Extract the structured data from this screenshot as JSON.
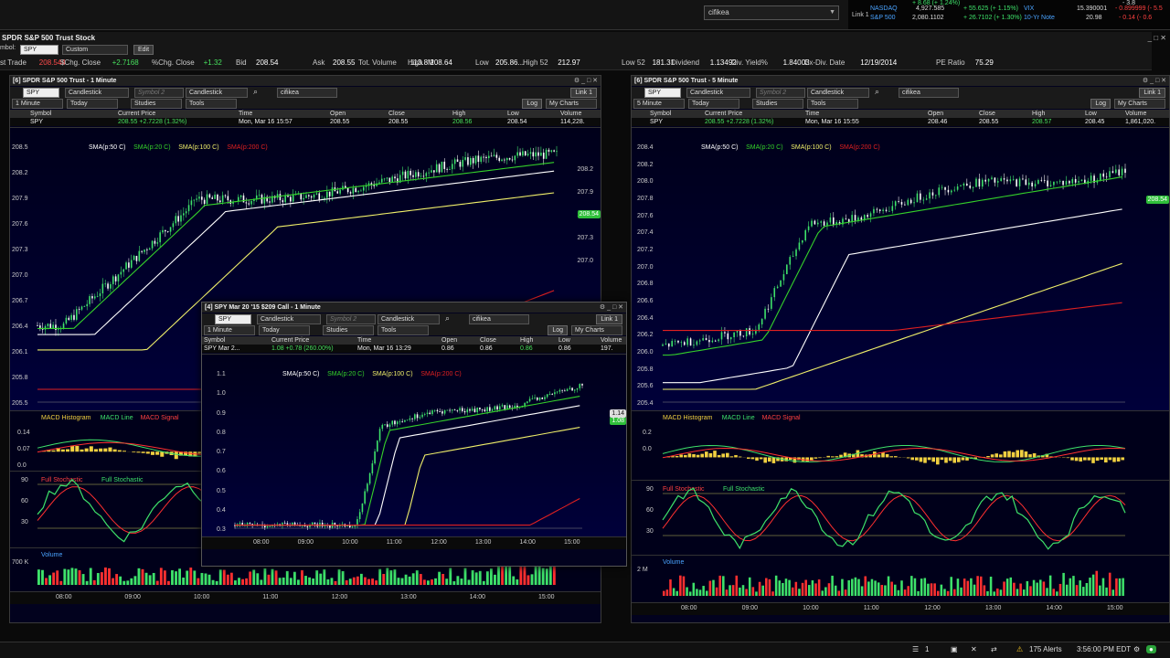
{
  "command": {
    "value": "cifikea"
  },
  "tickers": [
    {
      "name": "NASDAQ",
      "value": "4,927.585",
      "change": "+ 55.625 (+ 1.15%)",
      "name2": "VIX",
      "value2": "15.390001",
      "change2": "- 0.899999 (- 5.5"
    },
    {
      "name": "S&P 500",
      "value": "2,080.1102",
      "change": "+ 26.7102 (+ 1.30%)",
      "name2": "10-Yr Note",
      "value2": "20.98",
      "change2": "- 0.14 (- 0.6"
    }
  ],
  "link_label": "Link 1",
  "main": {
    "title": "SPDR S&P 500 Trust Stock",
    "symbol_label": "mbol:",
    "symbol": "SPY",
    "layout": "Custom",
    "edit_label": "Edit",
    "quote": [
      {
        "label": "st Trade",
        "value": "208.544",
        "tone": "red"
      },
      {
        "label": "$Chg. Close",
        "value": "+2.7168",
        "tone": "green"
      },
      {
        "label": "%Chg. Close",
        "value": "+1.32",
        "tone": "green"
      },
      {
        "label": "Bid",
        "value": "208.54",
        "tone": "val"
      },
      {
        "label": "Ask",
        "value": "208.55",
        "tone": "val"
      },
      {
        "label": "Tot. Volume",
        "value": "113.8M",
        "tone": "val"
      },
      {
        "label": "High",
        "value": "208.64",
        "tone": "val"
      },
      {
        "label": "Low",
        "value": "205.86...",
        "tone": "val"
      },
      {
        "label": "High 52",
        "value": "212.97",
        "tone": "val"
      },
      {
        "label": "Low 52",
        "value": "181.31",
        "tone": "val"
      },
      {
        "label": "Dividend",
        "value": "1.13492",
        "tone": "val"
      },
      {
        "label": "Div. Yield%",
        "value": "1.84003",
        "tone": "val"
      },
      {
        "label": "Ex-Div. Date",
        "value": "12/19/2014",
        "tone": "val"
      },
      {
        "label": "PE Ratio",
        "value": "75.29",
        "tone": "val"
      }
    ]
  },
  "toolbar_common": {
    "symbol2_placeholder": "Symbol 2",
    "style": "Candlestick",
    "today": "Today",
    "studies": "Studies",
    "tools": "Tools",
    "log": "Log",
    "my_charts": "My Charts",
    "links": "Link 1",
    "sub_symbol": "cifikea"
  },
  "panels": [
    {
      "id": "left",
      "title": "[6] SPDR S&P 500 Trust - 1 Minute",
      "interval": "1 Minute",
      "symbol": "SPY",
      "headers": [
        "Symbol",
        "Current Price",
        "Time",
        "Open",
        "Close",
        "High",
        "Low",
        "Volume"
      ],
      "row": [
        "SPY",
        "208.55 +2.7228 (1.32%)",
        "Mon, Mar 16  15:57",
        "208.55",
        "208.55",
        "208.56",
        "208.54",
        "114,228."
      ],
      "sma": [
        "SMA(p:50 C)",
        "SMA(p:20 C)",
        "SMA(p:100 C)",
        "SMA(p:200 C)"
      ],
      "yticks": [
        "208.5",
        "208.2",
        "207.9",
        "207.6",
        "207.3",
        "207.0",
        "206.7",
        "206.4",
        "206.1",
        "205.8",
        "205.5"
      ],
      "ticks_r": [
        "208.2",
        "207.9",
        "207.6",
        "207.3",
        "207.0"
      ],
      "last": "208.54",
      "macd_labels": [
        "MACD Histogram",
        "MACD Line",
        "MACD Signal"
      ],
      "macd_ticks": [
        "0.14",
        "0.07",
        "0.0"
      ],
      "stoch_labels": [
        "Full Stochastic",
        "Full Stochastic"
      ],
      "stoch_ticks": [
        "90",
        "60",
        "30"
      ],
      "volume_label": "Volume",
      "vol_tick": "700 K",
      "xticks": [
        "08:00",
        "09:00",
        "10:00",
        "11:00",
        "12:00",
        "13:00",
        "14:00",
        "15:00"
      ]
    },
    {
      "id": "right",
      "title": "[6] SPDR S&P 500 Trust - 5 Minute",
      "interval": "5 Minute",
      "symbol": "SPY",
      "headers": [
        "Symbol",
        "Current Price",
        "Time",
        "Open",
        "Close",
        "High",
        "Low",
        "Volume"
      ],
      "row": [
        "SPY",
        "208.55 +2.7228 (1.32%)",
        "Mon, Mar 16  15:55",
        "208.46",
        "208.55",
        "208.57",
        "208.45",
        "1,861,020."
      ],
      "sma": [
        "SMA(p:50 C)",
        "SMA(p:20 C)",
        "SMA(p:100 C)",
        "SMA(p:200 C)"
      ],
      "yticks": [
        "208.4",
        "208.2",
        "208.0",
        "207.8",
        "207.6",
        "207.4",
        "207.2",
        "207.0",
        "206.8",
        "206.6",
        "206.4",
        "206.2",
        "206.0",
        "205.8",
        "205.6",
        "205.4"
      ],
      "last": "208.54",
      "macd_labels": [
        "MACD Histogram",
        "MACD Line",
        "MACD Signal"
      ],
      "macd_ticks": [
        "0.2",
        "0.0"
      ],
      "stoch_labels": [
        "Full Stochastic",
        "Full Stochastic"
      ],
      "stoch_ticks": [
        "90",
        "60",
        "30"
      ],
      "volume_label": "Volume",
      "vol_tick": "2 M",
      "xticks": [
        "08:00",
        "09:00",
        "10:00",
        "11:00",
        "12:00",
        "13:00",
        "14:00",
        "15:00"
      ]
    },
    {
      "id": "float",
      "title": "[4] SPY Mar 20 '15 $209 Call - 1 Minute",
      "interval": "1 Minute",
      "symbol": "SPY",
      "headers": [
        "Symbol",
        "Current Price",
        "Time",
        "Open",
        "Close",
        "High",
        "Low",
        "Volume"
      ],
      "row": [
        "SPY Mar 2...",
        "1.08 +0.78 (260.00%)",
        "Mon, Mar 16  13:29",
        "0.86",
        "0.86",
        "0.86",
        "0.86",
        "197."
      ],
      "sma": [
        "SMA(p:50 C)",
        "SMA(p:20 C)",
        "SMA(p:100 C)",
        "SMA(p:200 C)"
      ],
      "yticks": [
        "1.1",
        "1.0",
        "0.9",
        "0.8",
        "0.7",
        "0.6",
        "0.5",
        "0.4",
        "0.3"
      ],
      "last": "1.08",
      "last2": "1.14",
      "xticks": [
        "08:00",
        "09:00",
        "10:00",
        "11:00",
        "12:00",
        "13:00",
        "14:00",
        "15:00"
      ]
    }
  ],
  "status": {
    "alerts": "175 Alerts",
    "time": "3:56:00 PM EDT",
    "count": "1"
  },
  "colors": {
    "sma50": "#ffffff",
    "sma20": "#34d12a",
    "sma100": "#f0ef6a",
    "sma200": "#e02020"
  }
}
